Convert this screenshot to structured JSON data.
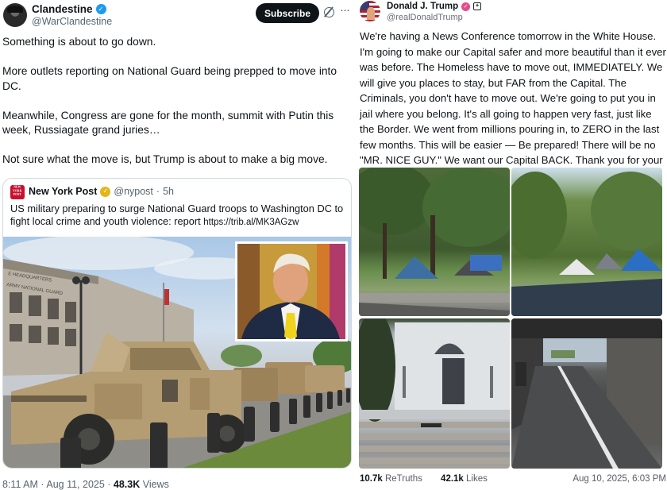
{
  "left_post": {
    "author_name": "Clandestine",
    "author_handle": "@WarClandestine",
    "subscribe_label": "Subscribe",
    "more_label": "···",
    "paragraphs": [
      "Something is about to go down.",
      "More outlets reporting on National Guard being prepped to move into DC.",
      "Meanwhile, Congress are gone for the month, summit with Putin this week, Russiagate grand juries…",
      "Not sure what the move is, but Trump is about to make a big move."
    ],
    "quote": {
      "avatar_text": "NEW YORK POST",
      "author_name": "New York Post",
      "author_handle": "@nypost",
      "separator": "·",
      "time": "5h",
      "text": "US military preparing to surge National Guard troops to Washington DC to fight local crime and youth violence: report ",
      "link": "https://trib.al/MK3AGzw",
      "building_label": "ARMY NATIONAL GUARD"
    },
    "footer": {
      "time": "8:11 AM · Aug 11, 2025 · ",
      "views_count": "48.3K",
      "views_label": " Views"
    },
    "colors": {
      "verified": "#1d9bf0",
      "nypost_verified": "#e2b719",
      "nypost_red": "#c8102e"
    }
  },
  "right_post": {
    "author_name": "Donald J. Trump",
    "author_handle": "@realDonaldTrump",
    "text": "We're having a News Conference tomorrow in the White House. I'm going to make our Capital safer and more beautiful than it ever was before. The Homeless have to move out, IMMEDIATELY. We will give you places to stay, but FAR from the Capital. The Criminals, you don't have to move out. We're going to put you in jail where you belong. It's all going to happen very fast, just like the Border. We went from millions pouring in, to ZERO in the last few months. This will be easier — Be prepared! There will be no \"MR. NICE GUY.\" We want our Capital BACK. Thank you for your attention to this matter!",
    "footer": {
      "retruths_count": "10.7k",
      "retruths_label": " ReTruths",
      "likes_count": "42.1k",
      "likes_label": " Likes",
      "timestamp": "Aug 10, 2025, 6:03 PM"
    },
    "colors": {
      "verified": "#e44d8a"
    }
  }
}
